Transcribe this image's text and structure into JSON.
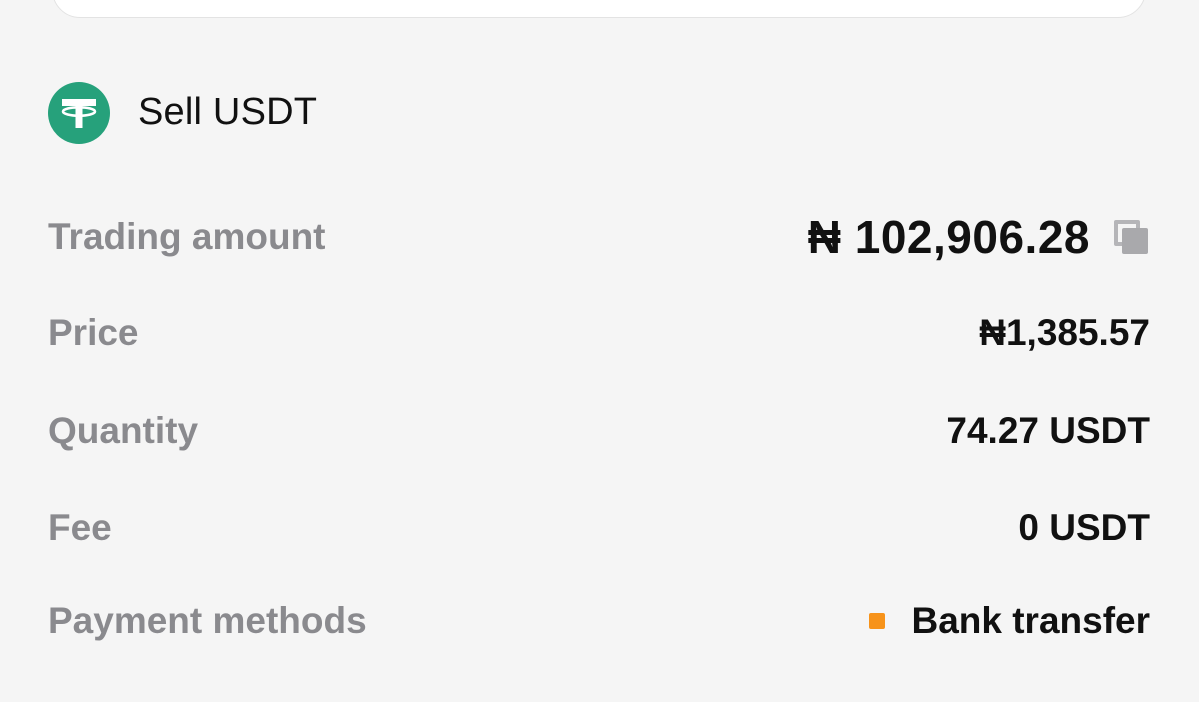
{
  "header": {
    "title": "Sell USDT",
    "coin_icon": "tether-icon",
    "coin_color": "#26a17b"
  },
  "details": {
    "trading_amount": {
      "label": "Trading amount",
      "value": "₦ 102,906.28",
      "copy_icon": "copy-icon"
    },
    "price": {
      "label": "Price",
      "value": "₦1,385.57"
    },
    "quantity": {
      "label": "Quantity",
      "value": "74.27 USDT"
    },
    "fee": {
      "label": "Fee",
      "value": "0 USDT"
    },
    "payment_methods": {
      "label": "Payment methods",
      "value": "Bank transfer",
      "marker_color": "#f7931a"
    }
  }
}
